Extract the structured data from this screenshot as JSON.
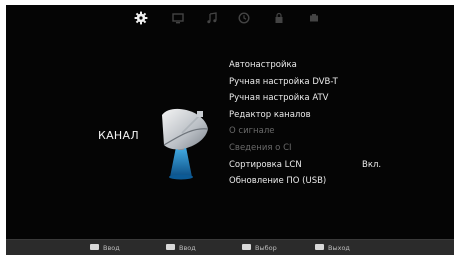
{
  "tabs": [
    {
      "icon": "gear-icon",
      "active": true
    },
    {
      "icon": "picture-icon",
      "active": false
    },
    {
      "icon": "music-note-icon",
      "active": false
    },
    {
      "icon": "clock-icon",
      "active": false
    },
    {
      "icon": "lock-icon",
      "active": false
    },
    {
      "icon": "usb-icon",
      "active": false
    }
  ],
  "section": {
    "title": "КАНАЛ",
    "icon": "satellite-dish-icon"
  },
  "menu": {
    "items": [
      {
        "label": "Автонастройка",
        "enabled": true
      },
      {
        "label": "Ручная настройка DVB-T",
        "enabled": true
      },
      {
        "label": "Ручная настройка ATV",
        "enabled": true
      },
      {
        "label": "Редактор каналов",
        "enabled": true
      },
      {
        "label": "О сигнале",
        "enabled": false
      },
      {
        "label": "Сведения о CI",
        "enabled": false
      },
      {
        "label": "Сортировка LCN",
        "enabled": true,
        "value": "Вкл."
      },
      {
        "label": "Обновление ПО (USB)",
        "enabled": true
      }
    ]
  },
  "footer": {
    "buttons": [
      {
        "label": "Ввод"
      },
      {
        "label": "Ввод"
      },
      {
        "label": "Выбор"
      },
      {
        "label": "Выход"
      }
    ]
  },
  "colors": {
    "background": "#050505",
    "text": "#ececec",
    "disabled_text": "#6a6a6a",
    "footer": "#2b2b2b",
    "active_tab": "#f0f0f0",
    "inactive_tab": "#444444"
  }
}
